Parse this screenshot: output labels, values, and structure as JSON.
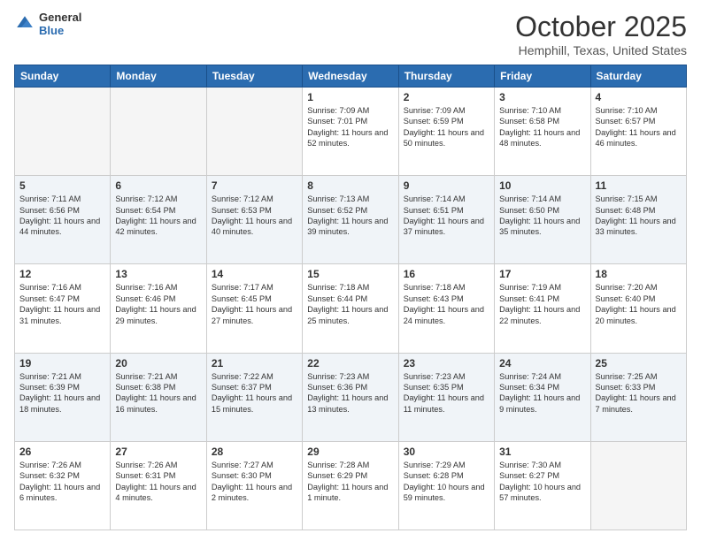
{
  "header": {
    "logo_general": "General",
    "logo_blue": "Blue",
    "month_title": "October 2025",
    "location": "Hemphill, Texas, United States"
  },
  "days_of_week": [
    "Sunday",
    "Monday",
    "Tuesday",
    "Wednesday",
    "Thursday",
    "Friday",
    "Saturday"
  ],
  "weeks": [
    [
      {
        "day": "",
        "empty": true
      },
      {
        "day": "",
        "empty": true
      },
      {
        "day": "",
        "empty": true
      },
      {
        "day": "1",
        "sunrise": "7:09 AM",
        "sunset": "7:01 PM",
        "daylight": "11 hours and 52 minutes."
      },
      {
        "day": "2",
        "sunrise": "7:09 AM",
        "sunset": "6:59 PM",
        "daylight": "11 hours and 50 minutes."
      },
      {
        "day": "3",
        "sunrise": "7:10 AM",
        "sunset": "6:58 PM",
        "daylight": "11 hours and 48 minutes."
      },
      {
        "day": "4",
        "sunrise": "7:10 AM",
        "sunset": "6:57 PM",
        "daylight": "11 hours and 46 minutes."
      }
    ],
    [
      {
        "day": "5",
        "sunrise": "7:11 AM",
        "sunset": "6:56 PM",
        "daylight": "11 hours and 44 minutes."
      },
      {
        "day": "6",
        "sunrise": "7:12 AM",
        "sunset": "6:54 PM",
        "daylight": "11 hours and 42 minutes."
      },
      {
        "day": "7",
        "sunrise": "7:12 AM",
        "sunset": "6:53 PM",
        "daylight": "11 hours and 40 minutes."
      },
      {
        "day": "8",
        "sunrise": "7:13 AM",
        "sunset": "6:52 PM",
        "daylight": "11 hours and 39 minutes."
      },
      {
        "day": "9",
        "sunrise": "7:14 AM",
        "sunset": "6:51 PM",
        "daylight": "11 hours and 37 minutes."
      },
      {
        "day": "10",
        "sunrise": "7:14 AM",
        "sunset": "6:50 PM",
        "daylight": "11 hours and 35 minutes."
      },
      {
        "day": "11",
        "sunrise": "7:15 AM",
        "sunset": "6:48 PM",
        "daylight": "11 hours and 33 minutes."
      }
    ],
    [
      {
        "day": "12",
        "sunrise": "7:16 AM",
        "sunset": "6:47 PM",
        "daylight": "11 hours and 31 minutes."
      },
      {
        "day": "13",
        "sunrise": "7:16 AM",
        "sunset": "6:46 PM",
        "daylight": "11 hours and 29 minutes."
      },
      {
        "day": "14",
        "sunrise": "7:17 AM",
        "sunset": "6:45 PM",
        "daylight": "11 hours and 27 minutes."
      },
      {
        "day": "15",
        "sunrise": "7:18 AM",
        "sunset": "6:44 PM",
        "daylight": "11 hours and 25 minutes."
      },
      {
        "day": "16",
        "sunrise": "7:18 AM",
        "sunset": "6:43 PM",
        "daylight": "11 hours and 24 minutes."
      },
      {
        "day": "17",
        "sunrise": "7:19 AM",
        "sunset": "6:41 PM",
        "daylight": "11 hours and 22 minutes."
      },
      {
        "day": "18",
        "sunrise": "7:20 AM",
        "sunset": "6:40 PM",
        "daylight": "11 hours and 20 minutes."
      }
    ],
    [
      {
        "day": "19",
        "sunrise": "7:21 AM",
        "sunset": "6:39 PM",
        "daylight": "11 hours and 18 minutes."
      },
      {
        "day": "20",
        "sunrise": "7:21 AM",
        "sunset": "6:38 PM",
        "daylight": "11 hours and 16 minutes."
      },
      {
        "day": "21",
        "sunrise": "7:22 AM",
        "sunset": "6:37 PM",
        "daylight": "11 hours and 15 minutes."
      },
      {
        "day": "22",
        "sunrise": "7:23 AM",
        "sunset": "6:36 PM",
        "daylight": "11 hours and 13 minutes."
      },
      {
        "day": "23",
        "sunrise": "7:23 AM",
        "sunset": "6:35 PM",
        "daylight": "11 hours and 11 minutes."
      },
      {
        "day": "24",
        "sunrise": "7:24 AM",
        "sunset": "6:34 PM",
        "daylight": "11 hours and 9 minutes."
      },
      {
        "day": "25",
        "sunrise": "7:25 AM",
        "sunset": "6:33 PM",
        "daylight": "11 hours and 7 minutes."
      }
    ],
    [
      {
        "day": "26",
        "sunrise": "7:26 AM",
        "sunset": "6:32 PM",
        "daylight": "11 hours and 6 minutes."
      },
      {
        "day": "27",
        "sunrise": "7:26 AM",
        "sunset": "6:31 PM",
        "daylight": "11 hours and 4 minutes."
      },
      {
        "day": "28",
        "sunrise": "7:27 AM",
        "sunset": "6:30 PM",
        "daylight": "11 hours and 2 minutes."
      },
      {
        "day": "29",
        "sunrise": "7:28 AM",
        "sunset": "6:29 PM",
        "daylight": "11 hours and 1 minute."
      },
      {
        "day": "30",
        "sunrise": "7:29 AM",
        "sunset": "6:28 PM",
        "daylight": "10 hours and 59 minutes."
      },
      {
        "day": "31",
        "sunrise": "7:30 AM",
        "sunset": "6:27 PM",
        "daylight": "10 hours and 57 minutes."
      },
      {
        "day": "",
        "empty": true
      }
    ]
  ],
  "labels": {
    "sunrise": "Sunrise:",
    "sunset": "Sunset:",
    "daylight": "Daylight:"
  }
}
